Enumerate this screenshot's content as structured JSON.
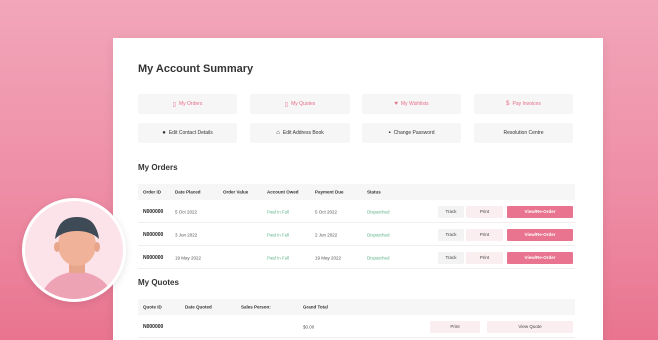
{
  "page": {
    "title": "My Account Summary"
  },
  "quick_links": [
    {
      "label": "My Orders",
      "icon": "document-icon"
    },
    {
      "label": "My Quotes",
      "icon": "document-icon"
    },
    {
      "label": "My Wishlists",
      "icon": "heart-icon"
    },
    {
      "label": "Pay Invoices",
      "icon": "dollar-icon"
    },
    {
      "label": "Edit Contact Details",
      "icon": "user-icon"
    },
    {
      "label": "Edit Address Book",
      "icon": "home-icon"
    },
    {
      "label": "Change Password",
      "icon": "lock-icon"
    },
    {
      "label": "Resolution Centre",
      "icon": ""
    }
  ],
  "orders": {
    "heading": "My Orders",
    "columns": [
      "Order ID",
      "Date Placed",
      "Order Value",
      "Account Owed",
      "Payment Due",
      "Status"
    ],
    "rows": [
      {
        "id": "N000000",
        "date": "5 Oct 2022",
        "owed": "Paid in Full",
        "due": "5 Oct 2022",
        "status": "Dispatched"
      },
      {
        "id": "N000000",
        "date": "3 Jun 2022",
        "owed": "Paid in Full",
        "due": "2 Jun 2022",
        "status": "Dispatched"
      },
      {
        "id": "N000000",
        "date": "19 May 2022",
        "owed": "Paid in Full",
        "due": "19 May 2022",
        "status": "Dispatched"
      }
    ],
    "track_label": "Track",
    "print_label": "Print",
    "reorder_label": "View/Re-Order"
  },
  "quotes": {
    "heading": "My Quotes",
    "columns": [
      "Quote ID",
      "Date Quoted",
      "Sales Person:",
      "Grand Total"
    ],
    "rows": [
      {
        "id": "N000000",
        "total": "$0.00"
      }
    ],
    "print_label": "Print",
    "view_label": "View Quote"
  },
  "colors": {
    "accent": "#e9748f",
    "paid": "#5fb38b",
    "background": "#ee8ea6"
  }
}
